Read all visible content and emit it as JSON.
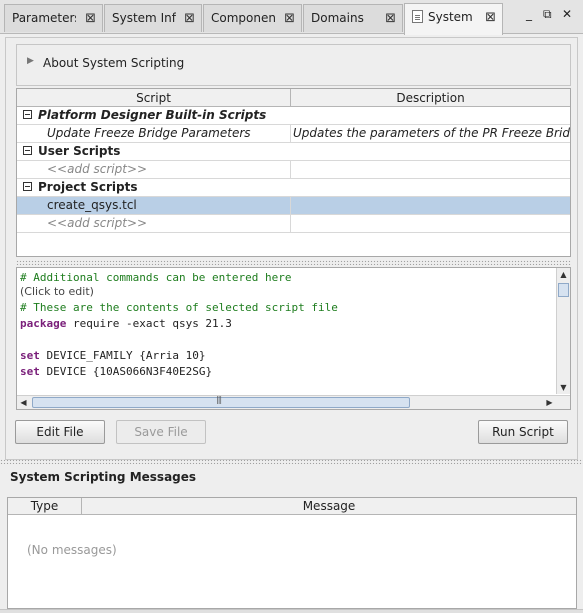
{
  "tabs": [
    {
      "label": "Parameters",
      "active": false
    },
    {
      "label": "System Info",
      "active": false
    },
    {
      "label": "Components",
      "active": false
    },
    {
      "label": "Domains",
      "active": false
    },
    {
      "label": "System",
      "active": true
    }
  ],
  "window_controls": {
    "minimize": "_",
    "restore": "▫",
    "close": "✕"
  },
  "about": {
    "label": "About System Scripting"
  },
  "script_table": {
    "headers": {
      "script": "Script",
      "description": "Description"
    },
    "groups": {
      "builtin": "Platform Designer Built-in Scripts",
      "user": "User Scripts",
      "project": "Project Scripts"
    },
    "builtin_row": {
      "script": "Update Freeze Bridge Parameters",
      "description": "Updates the parameters of the PR Freeze Bridg..."
    },
    "add_script": "<<add script>>",
    "project_row": {
      "script": "create_qsys.tcl",
      "description": ""
    }
  },
  "editor": {
    "line1": "# Additional commands can be entered here",
    "hint": "(Click to edit)",
    "line3": "# These are the contents of selected script file",
    "line4_kw": "package",
    "line4_rest": " require -exact qsys 21.3",
    "line6_kw": "set",
    "line6_rest": " DEVICE_FAMILY {Arria 10}",
    "line7_kw": "set",
    "line7_rest": " DEVICE {10AS066N3F40E2SG}"
  },
  "buttons": {
    "edit_file": "Edit File",
    "save_file": "Save File",
    "run_script": "Run Script"
  },
  "messages": {
    "title": "System Scripting Messages",
    "headers": {
      "type": "Type",
      "message": "Message"
    },
    "empty": "(No messages)"
  }
}
